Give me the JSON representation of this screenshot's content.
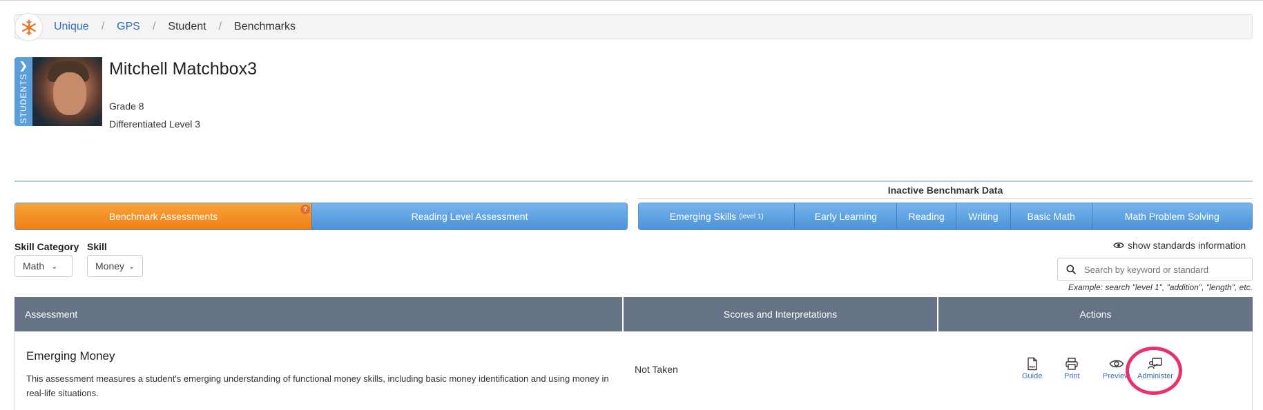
{
  "breadcrumb": {
    "items": [
      {
        "label": "Unique",
        "link": true
      },
      {
        "label": "GPS",
        "link": true
      },
      {
        "label": "Student",
        "link": false
      },
      {
        "label": "Benchmarks",
        "link": false
      }
    ],
    "separator": "/"
  },
  "student": {
    "tab_label": "STUDENTS",
    "name": "Mitchell Matchbox3",
    "grade": "Grade 8",
    "level": "Differentiated Level 3"
  },
  "tabs": {
    "active_group": [
      {
        "label": "Benchmark Assessments",
        "active": true,
        "badge": "?"
      },
      {
        "label": "Reading Level Assessment",
        "active": false
      }
    ],
    "inactive_group_label": "Inactive Benchmark Data",
    "inactive_group": [
      {
        "label": "Emerging Skills",
        "sub": "(level 1)"
      },
      {
        "label": "Early Learning"
      },
      {
        "label": "Reading"
      },
      {
        "label": "Writing"
      },
      {
        "label": "Basic Math"
      },
      {
        "label": "Math Problem Solving"
      }
    ]
  },
  "filters": {
    "category_label": "Skill Category",
    "category_value": "Math",
    "skill_label": "Skill",
    "skill_value": "Money"
  },
  "standards": {
    "toggle_label": "show standards information",
    "search_placeholder": "Search by keyword or standard",
    "example": "Example: search \"level 1\", \"addition\", \"length\", etc."
  },
  "table": {
    "headers": [
      "Assessment",
      "Scores and Interpretations",
      "Actions"
    ],
    "rows": [
      {
        "title": "Emerging Money",
        "description": "This assessment measures a student's emerging understanding of functional money skills, including basic money identification and using money in real-life situations.",
        "score": "Not Taken",
        "actions": [
          "Guide",
          "Print",
          "Preview",
          "Administer"
        ]
      }
    ]
  },
  "colors": {
    "accent_orange": "#ee7f16",
    "tab_blue": "#5a9fdc",
    "header_gray": "#667286",
    "highlight": "#e8336a"
  }
}
